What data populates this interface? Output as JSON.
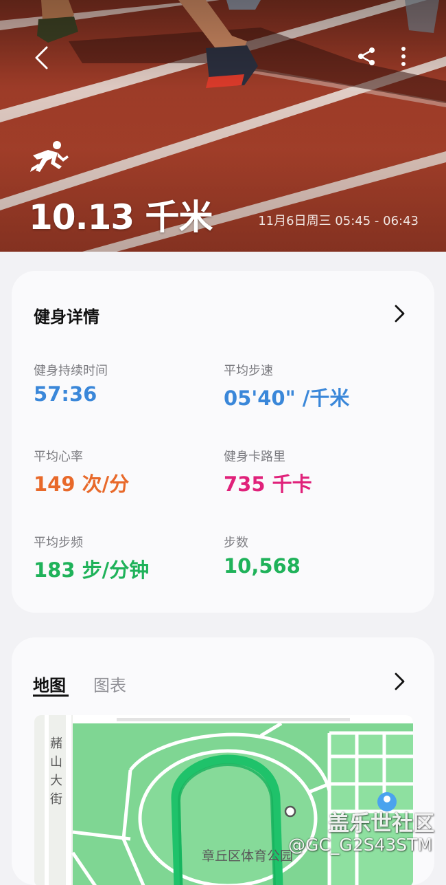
{
  "header": {
    "distance": "10.13 千米",
    "datetime": "11月6日周三 05:45 - 06:43",
    "icons": {
      "back": "back-arrow-icon",
      "share": "share-icon",
      "more": "more-vertical-icon",
      "activity": "running-icon"
    }
  },
  "details": {
    "title": "健身详情",
    "stats": [
      {
        "label": "健身持续时间",
        "value": "57:36",
        "color": "#3a87d9"
      },
      {
        "label": "平均步速",
        "value": "05'40\" /千米",
        "color": "#3a87d9"
      },
      {
        "label": "平均心率",
        "value": "149 次/分",
        "color": "#e8692a"
      },
      {
        "label": "健身卡路里",
        "value": "735 千卡",
        "color": "#e0217a"
      },
      {
        "label": "平均步频",
        "value": "183 步/分钟",
        "color": "#1fb25a"
      },
      {
        "label": "步数",
        "value": "10,568",
        "color": "#1fb25a"
      }
    ]
  },
  "map_card": {
    "tabs": [
      {
        "label": "地图",
        "active": true
      },
      {
        "label": "图表",
        "active": false
      }
    ],
    "map": {
      "street_label": "赭山大街",
      "park_label": "章丘区体育公园",
      "route_color": "#1fc26a"
    }
  },
  "watermark": {
    "line1": "盖乐世社区",
    "line2": "@GC_G2S43STM"
  }
}
